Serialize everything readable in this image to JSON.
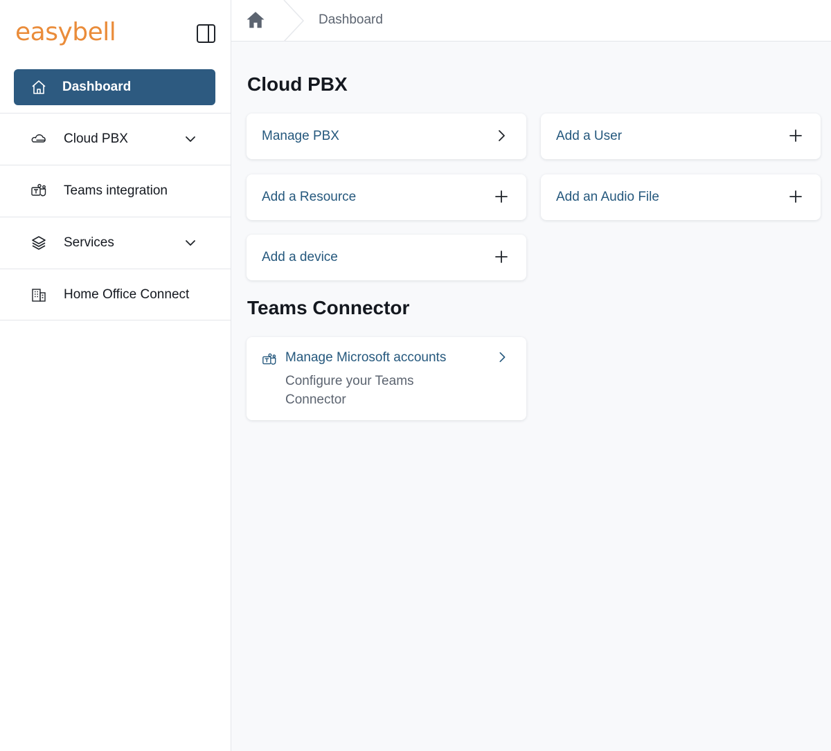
{
  "brand": {
    "logo_text": "easybell",
    "color": "#ea8c3a"
  },
  "sidebar": {
    "toggle_icon": "sidebar-toggle-icon",
    "active_item": {
      "label": "Dashboard",
      "icon": "home-icon"
    },
    "items": [
      {
        "label": "Cloud PBX",
        "icon": "cloud-icon",
        "expandable": true
      },
      {
        "label": "Teams integration",
        "icon": "teams-icon",
        "expandable": false
      },
      {
        "label": "Services",
        "icon": "layers-icon",
        "expandable": true
      },
      {
        "label": "Home Office Connect",
        "icon": "building-icon",
        "expandable": false
      }
    ]
  },
  "breadcrumb": {
    "home_icon": "home-icon",
    "current": "Dashboard"
  },
  "sections": {
    "cloud_pbx": {
      "title": "Cloud PBX",
      "cards": [
        {
          "label": "Manage PBX",
          "action": "chevron-right-icon"
        },
        {
          "label": "Add a User",
          "action": "plus-icon"
        },
        {
          "label": "Add a Resource",
          "action": "plus-icon"
        },
        {
          "label": "Add an Audio File",
          "action": "plus-icon"
        },
        {
          "label": "Add a device",
          "action": "plus-icon"
        }
      ]
    },
    "teams_connector": {
      "title": "Teams Connector",
      "card": {
        "title": "Manage Microsoft accounts",
        "description": "Configure your Teams Connector",
        "icon": "teams-icon",
        "action": "chevron-right-icon"
      }
    }
  },
  "colors": {
    "primary": "#2d5a80",
    "link": "#25587d",
    "muted": "#5c6470",
    "background": "#f8f9fb"
  }
}
